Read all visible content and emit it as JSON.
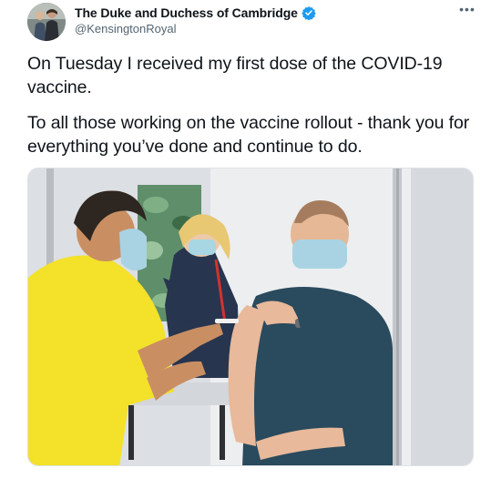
{
  "tweet": {
    "display_name": "The Duke and Duchess of Cambridge",
    "handle": "@KensingtonRoyal",
    "more_label": "•••",
    "paragraphs": [
      "On Tuesday I received my first dose of the COVID-19 vaccine.",
      "To all those working on the vaccine rollout - thank you for everything you’ve done and continue to do."
    ],
    "verified_color": "#1d9bf0"
  },
  "icons": {
    "verified": "verified-badge-icon",
    "more": "more-options-icon"
  }
}
